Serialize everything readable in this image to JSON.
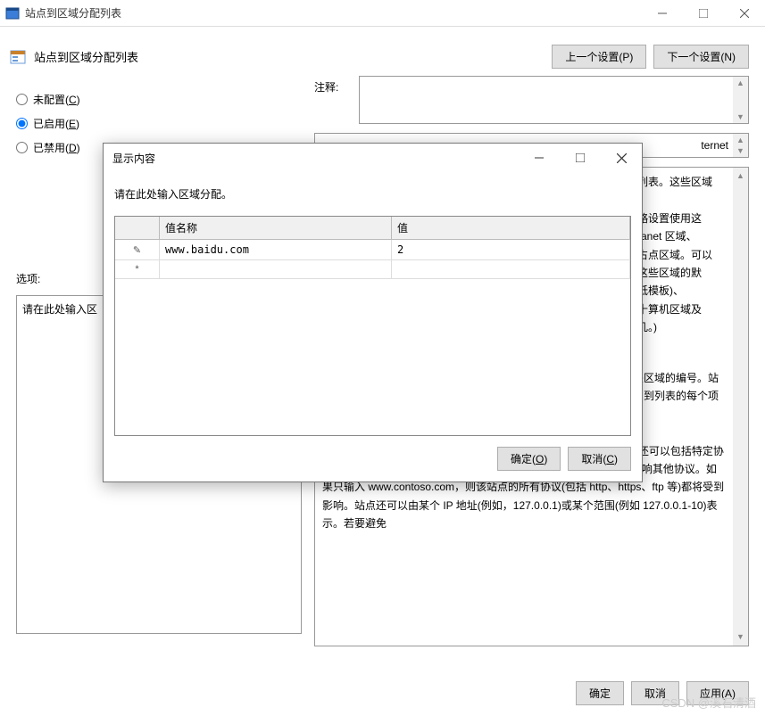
{
  "window": {
    "title": "站点到区域分配列表"
  },
  "header": {
    "title": "站点到区域分配列表",
    "prev_button": "上一个设置(P)",
    "next_button": "下一个设置(N)"
  },
  "state_radios": {
    "not_configured": "未配置(C)",
    "enabled": "已启用(E)",
    "disabled": "已禁用(D)",
    "selected": "enabled"
  },
  "comment_label": "注释:",
  "options_label": "选项:",
  "options_placeholder": "请在此处输入区",
  "support_hint": "ternet",
  "help_fragments": {
    "r1": "列表。这些区域",
    "r2": "略设置使用这",
    "r3": "ranet 区域、",
    "r4": "占点区域。可以",
    "r5": "这些区域的默",
    "r6": "低模板)、",
    "r7": "十算机区域及",
    "r8": "几。)"
  },
  "help_body": "如果启用此策略设置，则可以输入一个列表，其中列出站点及其相关区域的编号。站点与区域的关联会确保将特定区域的安全设置应用于该站点。为添加到列表的每个项目输入以下信息:\n\n值名 – Intranet 站点的主机，或其他站点的完全限定的域名。\"值名\"还可以包括特定协议。例如，如果输入 http://www.contoso.com 作为\"值名\"，并不会影响其他协议。如果只输入 www.contoso.com，则该站点的所有协议(包括 http、https、ftp 等)都将受到影响。站点还可以由某个 IP 地址(例如，127.0.0.1)或某个范围(例如 127.0.0.1-10)表示。若要避免",
  "bottom_buttons": {
    "ok": "确定",
    "cancel": "取消",
    "apply": "应用(A)"
  },
  "modal": {
    "title": "显示内容",
    "instruction": "请在此处输入区域分配。",
    "columns": {
      "name": "值名称",
      "value": "值"
    },
    "rows": [
      {
        "name": "www.baidu.com",
        "value": "2"
      }
    ],
    "ok_button": "确定(O)",
    "cancel_button": "取消(C)"
  },
  "watermark": "CSDN @溪石清酒"
}
